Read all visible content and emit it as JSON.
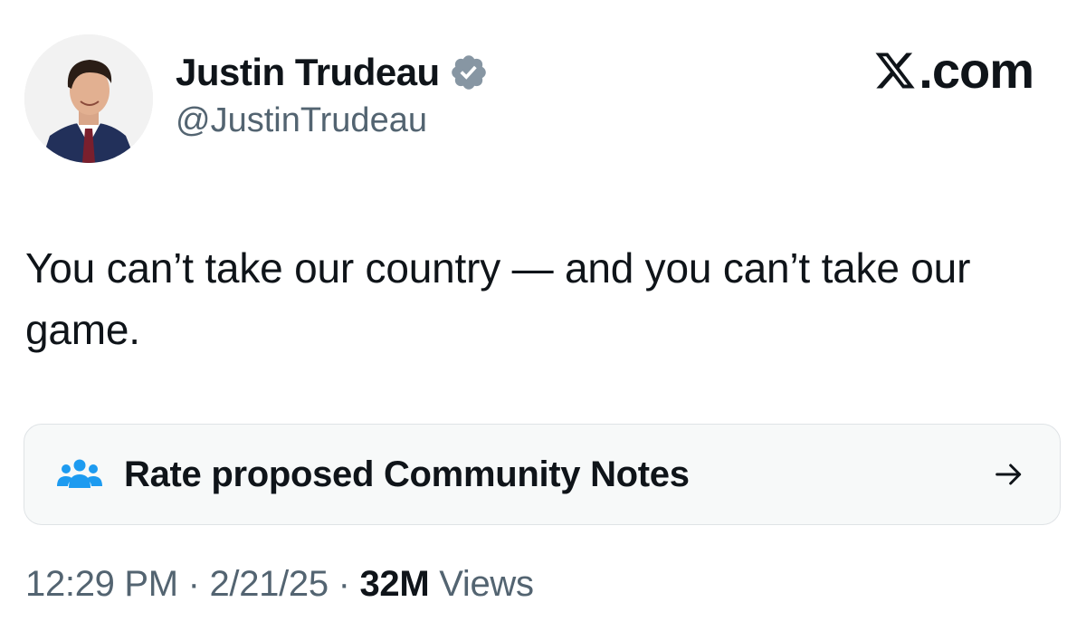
{
  "header": {
    "display_name": "Justin Trudeau",
    "handle": "@JustinTrudeau",
    "verified_icon": "verified-badge-icon",
    "brand": ".com",
    "brand_icon": "x-logo-icon"
  },
  "tweet": {
    "text": "You can’t take our country — and you can’t take our game."
  },
  "community_notes": {
    "label": "Rate proposed Community Notes",
    "icon": "people-icon",
    "arrow": "arrow-right-icon",
    "icon_color": "#1d9bf0"
  },
  "meta": {
    "time": "12:29 PM",
    "sep1": " · ",
    "date": "2/21/25",
    "sep2": " · ",
    "views_count": "32M",
    "views_label": " Views"
  },
  "colors": {
    "text_primary": "#0f1419",
    "text_secondary": "#536471",
    "verified": "#8796a3",
    "notes_bg": "#f7f9f9"
  }
}
